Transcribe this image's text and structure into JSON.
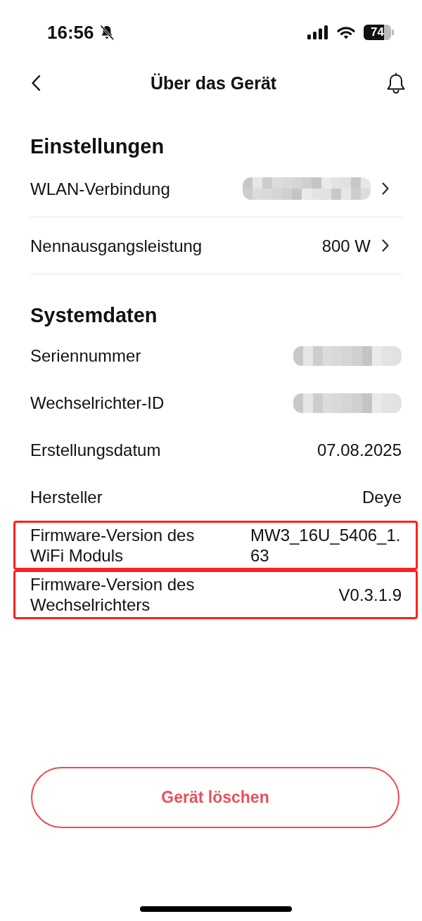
{
  "status_bar": {
    "time": "16:56",
    "battery": "74"
  },
  "header": {
    "title": "Über das Gerät"
  },
  "sections": [
    {
      "title": "Einstellungen",
      "rows": [
        {
          "kind": "nav",
          "label": "WLAN-Verbindung",
          "redacted": true
        },
        {
          "kind": "nav",
          "label": "Nennausgangsleistung",
          "value": "800 W",
          "redacted": false
        }
      ]
    },
    {
      "title": "Systemdaten",
      "rows": [
        {
          "kind": "info",
          "label": "Seriennummer",
          "redacted": true,
          "highlighted": false
        },
        {
          "kind": "info",
          "label": "Wechselrichter-ID",
          "redacted": true,
          "highlighted": false
        },
        {
          "kind": "info",
          "label": "Erstellungsdatum",
          "value": "07.08.2025",
          "redacted": false,
          "highlighted": false
        },
        {
          "kind": "info",
          "label": "Hersteller",
          "value": "Deye",
          "redacted": false,
          "highlighted": false
        },
        {
          "kind": "info",
          "label": "Firmware-Version des WiFi Moduls",
          "value": "MW3_16U_5406_1.63",
          "redacted": false,
          "highlighted": true
        },
        {
          "kind": "info",
          "label": "Firmware-Version des Wechselrichters",
          "value": "V0.3.1.9",
          "redacted": false,
          "highlighted": true
        }
      ]
    }
  ],
  "delete_button": {
    "label": "Gerät löschen"
  }
}
